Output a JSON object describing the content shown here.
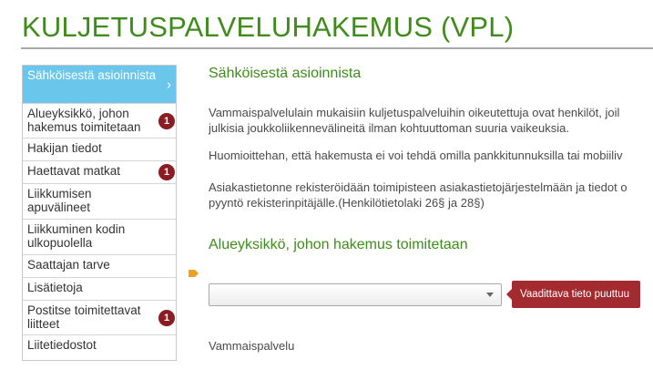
{
  "page": {
    "title": "KULJETUSPALVELUHAKEMUS (VPL)"
  },
  "sidebar": {
    "items": [
      {
        "label": "Sähköisestä asioinnista",
        "active": true,
        "badge": ""
      },
      {
        "label": "Alueyksikkö, johon hakemus toimitetaan",
        "active": false,
        "badge": "1"
      },
      {
        "label": "Hakijan tiedot",
        "active": false,
        "badge": ""
      },
      {
        "label": "Haettavat matkat",
        "active": false,
        "badge": "1"
      },
      {
        "label": "Liikkumisen apuvälineet",
        "active": false,
        "badge": ""
      },
      {
        "label": "Liikkuminen kodin ulkopuolella",
        "active": false,
        "badge": ""
      },
      {
        "label": "Saattajan tarve",
        "active": false,
        "badge": ""
      },
      {
        "label": "Lisätietoja",
        "active": false,
        "badge": ""
      },
      {
        "label": "Postitse toimitettavat liitteet",
        "active": false,
        "badge": "1"
      },
      {
        "label": "Liitetiedostot",
        "active": false,
        "badge": ""
      }
    ]
  },
  "main": {
    "section1_title": "Sähköisestä asioinnista",
    "para1_line1": "Vammaispalvelulain mukaisiin kuljetuspalveluihin oikeutettuja ovat henkilöt, joil",
    "para1_line2": "julkisia joukkoliikennevälineitä ilman kohtuuttoman suuria vaikeuksia.",
    "para2_line1": "Huomioittehan, että hakemusta ei voi tehdä omilla pankkitunnuksilla tai mobiiliv",
    "para3_line1": "Asiakastietonne rekisteröidään toimipisteen asiakastietojärjestelmään ja tiedot o",
    "para3_line2": "pyyntö rekisterinpitäjälle.(Henkilötietolaki 26§ ja 28§)",
    "section2_title": "Alueyksikkö, johon hakemus toimitetaan",
    "select_value": "",
    "error_message": "Vaadittava tieto puuttuu",
    "field_label": "Vammaispalvelu"
  },
  "colors": {
    "brand_green": "#3f8c1c",
    "active_nav": "#6ac6ea",
    "badge": "#8a1d24",
    "error": "#a32a2f",
    "pin": "#f0a020"
  }
}
